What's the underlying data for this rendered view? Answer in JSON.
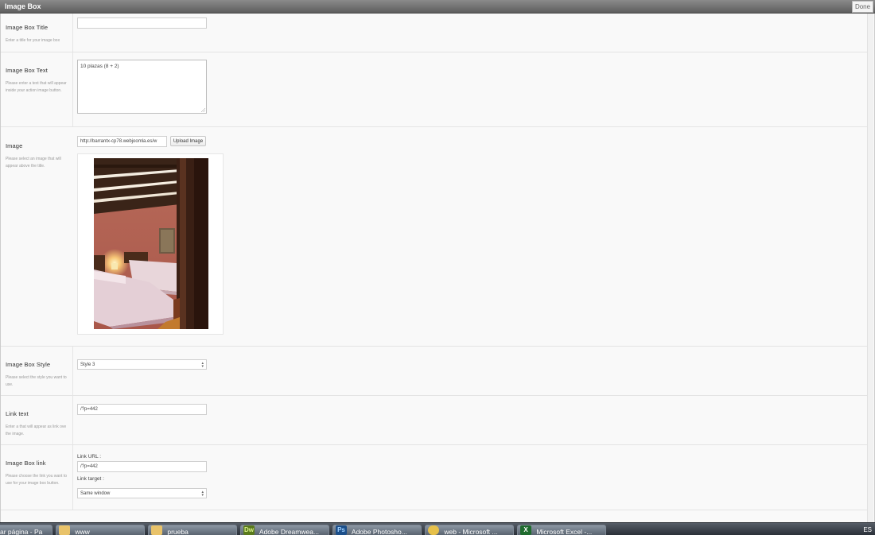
{
  "window": {
    "title": "Image Box",
    "done_label": "Done"
  },
  "fields": {
    "title": {
      "label": "Image Box Title",
      "description": "Enter a title for your image box",
      "value": ""
    },
    "text": {
      "label": "Image Box Text",
      "description": "Please enter a text that will appear inside your action image button.",
      "value": "10 plazas (8 + 2)"
    },
    "image": {
      "label": "Image",
      "description": "Please select an image that will appear above the title.",
      "url_value": "http://barrantx-cp78.webjoomla.es/w",
      "upload_label": "Upload Image"
    },
    "style": {
      "label": "Image Box Style",
      "description": "Please select the style you want to use.",
      "value": "Style 3"
    },
    "link_text": {
      "label": "Link text",
      "description": "Enter a that will appear as link ove the image.",
      "value": "/?p=442"
    },
    "link": {
      "label": "Image Box link",
      "description": "Please choose the link you want to use for your image box button.",
      "url_label": "Link URL :",
      "url_value": "/?p=442",
      "target_label": "Link target :",
      "target_value": "Same window"
    }
  },
  "taskbar": {
    "items": [
      {
        "label": "ar página - Pa",
        "icon": "browser-icon"
      },
      {
        "label": "www",
        "icon": "folder-icon"
      },
      {
        "label": "prueba",
        "icon": "folder-icon"
      },
      {
        "label": "Adobe Dreamwea...",
        "icon": "dreamweaver-icon"
      },
      {
        "label": "Adobe Photosho...",
        "icon": "photoshop-icon"
      },
      {
        "label": "web - Microsoft ...",
        "icon": "outlook-icon"
      },
      {
        "label": "Microsoft Excel -...",
        "icon": "excel-icon"
      }
    ],
    "language": "ES"
  },
  "colors": {
    "accent_dreamweaver": "#5a7a1c",
    "accent_photoshop": "#1c4f8a",
    "accent_excel": "#1f6b2e",
    "folder": "#e9c36a"
  }
}
